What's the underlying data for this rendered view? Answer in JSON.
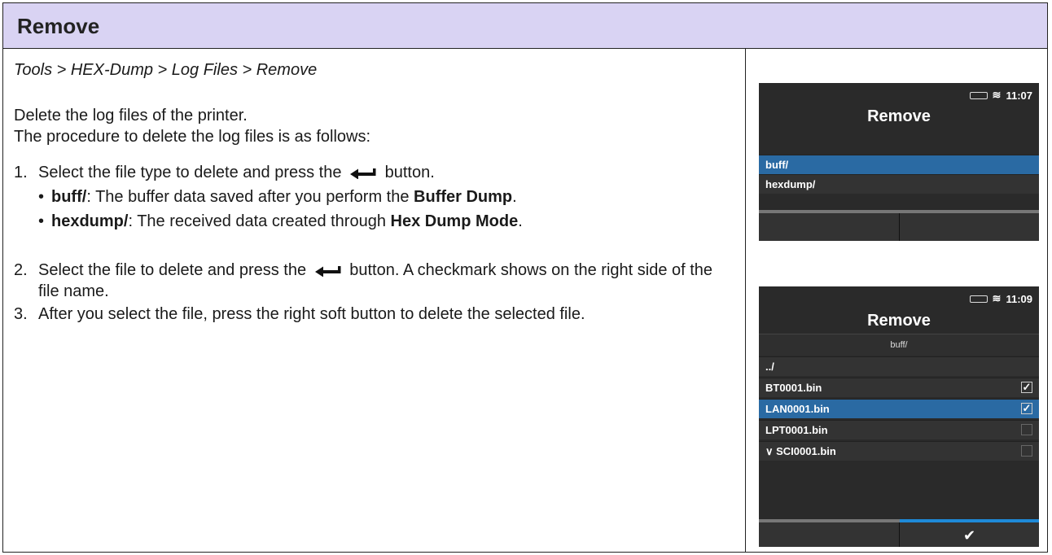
{
  "header": {
    "title": "Remove"
  },
  "breadcrumb": "Tools > HEX-Dump > Log Files > Remove",
  "intro": [
    "Delete the log files of the printer.",
    "The procedure to delete the log files is as follows:"
  ],
  "steps": [
    {
      "number": "1.",
      "before_icon": "Select the file type to delete and press the",
      "after_icon": "button.",
      "icon": "enter-arrow-icon",
      "bullets": [
        {
          "term": "buff/",
          "text_before": ": The buffer data saved after you perform the ",
          "bold_end": "Buffer Dump",
          "text_after": "."
        },
        {
          "term": "hexdump/",
          "text_before": ": The received data created through ",
          "bold_end": "Hex Dump Mode",
          "text_after": "."
        }
      ]
    },
    {
      "number": "2.",
      "before_icon": "Select the file to delete and press the",
      "after_icon": "button. A checkmark shows on the right side of the file name.",
      "icon": "enter-arrow-icon"
    },
    {
      "number": "3.",
      "text": "After you select the file, press the right soft button to delete the selected file."
    }
  ],
  "screen1": {
    "time": "11:07",
    "title": "Remove",
    "items": [
      {
        "label": "buff/",
        "selected": true
      },
      {
        "label": "hexdump/",
        "selected": false
      }
    ]
  },
  "screen2": {
    "time": "11:09",
    "title": "Remove",
    "path": "buff/",
    "items": [
      {
        "label": "../",
        "checked": null,
        "selected": false
      },
      {
        "label": "BT0001.bin",
        "checked": true,
        "selected": false
      },
      {
        "label": "LAN0001.bin",
        "checked": true,
        "selected": true
      },
      {
        "label": "LPT0001.bin",
        "checked": false,
        "selected": false
      },
      {
        "label": "∨ SCI0001.bin",
        "checked": false,
        "selected": false
      }
    ],
    "softkey_right": "✔"
  },
  "colors": {
    "header_bg": "#d9d3f3",
    "screen_bg": "#2a2a2a",
    "selection": "#2a6aa3",
    "accent": "#1e8ad8"
  }
}
